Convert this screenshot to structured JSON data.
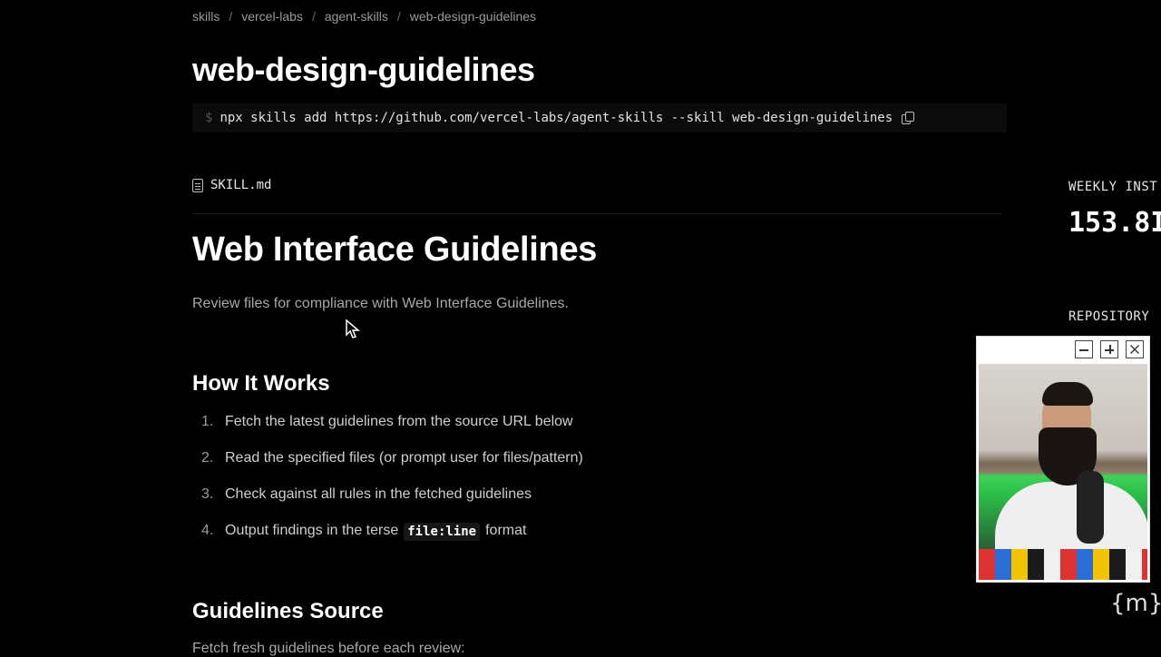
{
  "breadcrumb": [
    "skills",
    "vercel-labs",
    "agent-skills",
    "web-design-guidelines"
  ],
  "breadcrumb_sep": "/",
  "title": "web-design-guidelines",
  "install": {
    "prompt": "$",
    "command": "npx skills add https://github.com/vercel-labs/agent-skills --skill web-design-guidelines",
    "copy_icon": "copy-icon"
  },
  "file": {
    "name": "SKILL.md",
    "icon": "file-icon"
  },
  "doc": {
    "heading": "Web Interface Guidelines",
    "description": "Review files for compliance with Web Interface Guidelines.",
    "how_heading": "How It Works",
    "steps": [
      {
        "num": "1.",
        "text": "Fetch the latest guidelines from the source URL below"
      },
      {
        "num": "2.",
        "text": "Read the specified files (or prompt user for files/pattern)"
      },
      {
        "num": "3.",
        "text": "Check against all rules in the fetched guidelines"
      },
      {
        "num": "4.",
        "pre": "Output findings in the terse",
        "code": "file:line",
        "post": "format"
      }
    ],
    "source_heading": "Guidelines Source",
    "source_text": "Fetch fresh guidelines before each review:"
  },
  "sidebar": {
    "weekly_label": "WEEKLY INST",
    "weekly_value": "153.8I",
    "repo_label": "REPOSITORY"
  },
  "pip_window": {
    "controls": [
      "minimize-icon",
      "maximize-icon",
      "close-icon"
    ]
  },
  "brand_logo": "{m}",
  "colors": {
    "background": "#000000",
    "text": "#ededed",
    "muted": "#a8a8a8",
    "green_screen": "#2cbf48"
  }
}
